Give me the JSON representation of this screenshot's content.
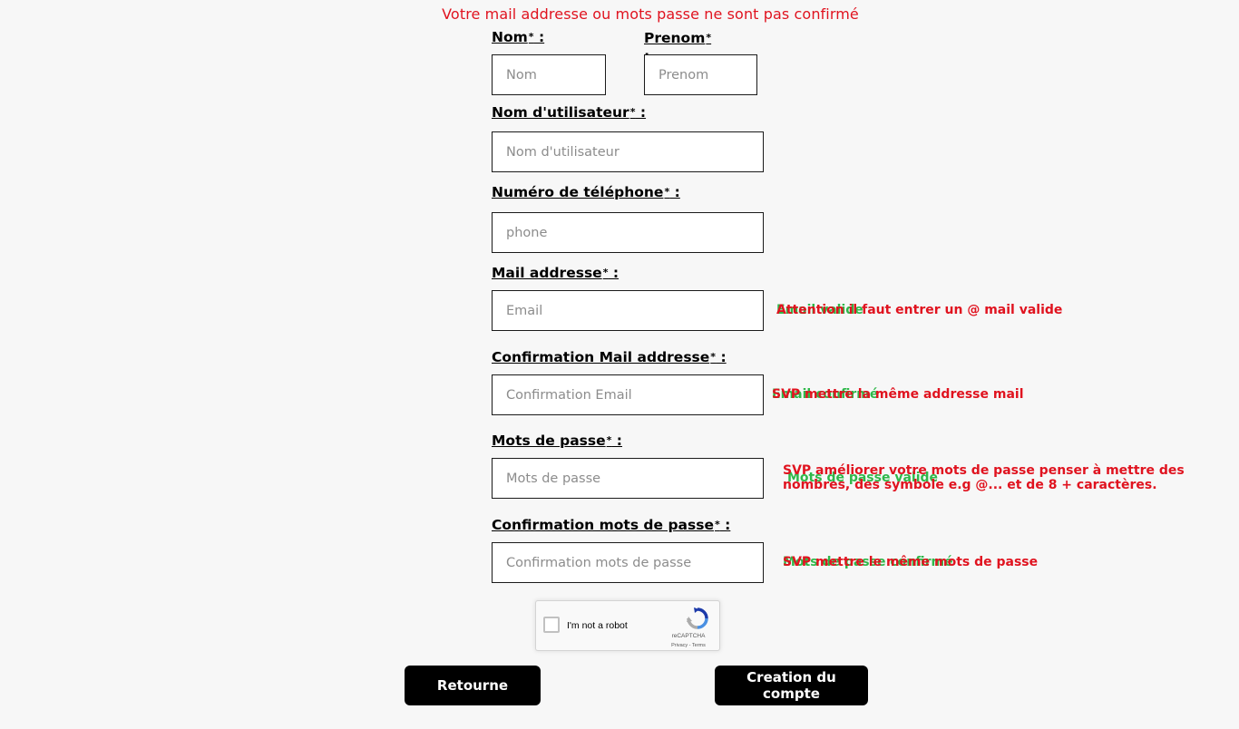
{
  "error_banner": "Votre mail addresse ou mots passe ne sont pas confirmé",
  "required_mark": "*",
  "label_suffix": " :",
  "colors": {
    "error": "#e0131f",
    "valid": "#2fb84a",
    "button_bg": "#000000",
    "button_text": "#ffffff",
    "background": "#f7f7f7"
  },
  "fields": {
    "nom": {
      "label": "Nom",
      "placeholder": "Nom",
      "value": ""
    },
    "prenom": {
      "label": "Prenom",
      "placeholder": "Prenom",
      "value": ""
    },
    "username": {
      "label": "Nom d'utilisateur",
      "placeholder": "Nom d'utilisateur",
      "value": ""
    },
    "phone": {
      "label": "Numéro de téléphone",
      "placeholder": "phone",
      "value": ""
    },
    "email": {
      "label": "Mail addresse",
      "placeholder": "Email",
      "value": "",
      "msg_valid": "Email valide",
      "msg_error": "Attention il faut entrer un @ mail valide"
    },
    "email_confirm": {
      "label": "Confirmation Mail addresse",
      "placeholder": "Confirmation Email",
      "value": "",
      "msg_valid": "Email confirmé",
      "msg_error": "SVP mettre la même addresse mail"
    },
    "password": {
      "label": "Mots de passe",
      "placeholder": "Mots de passe",
      "value": "",
      "msg_valid": "Mots de passe valide",
      "msg_error": "SVP améliorer votre mots de passe penser à mettre des nombres, des symbole e.g @... et de 8 + caractères."
    },
    "password_confirm": {
      "label": "Confirmation mots de passe",
      "placeholder": "Confirmation mots de passe",
      "value": "",
      "msg_valid": "Mots de passe confirmé",
      "msg_error": "SVP mettre le même mots de passe"
    }
  },
  "recaptcha": {
    "label": "I'm not a robot",
    "brand": "reCAPTCHA",
    "terms": "Privacy - Terms",
    "icon": "recaptcha-logo-icon"
  },
  "buttons": {
    "back": "Retourne",
    "create": "Creation du compte"
  }
}
